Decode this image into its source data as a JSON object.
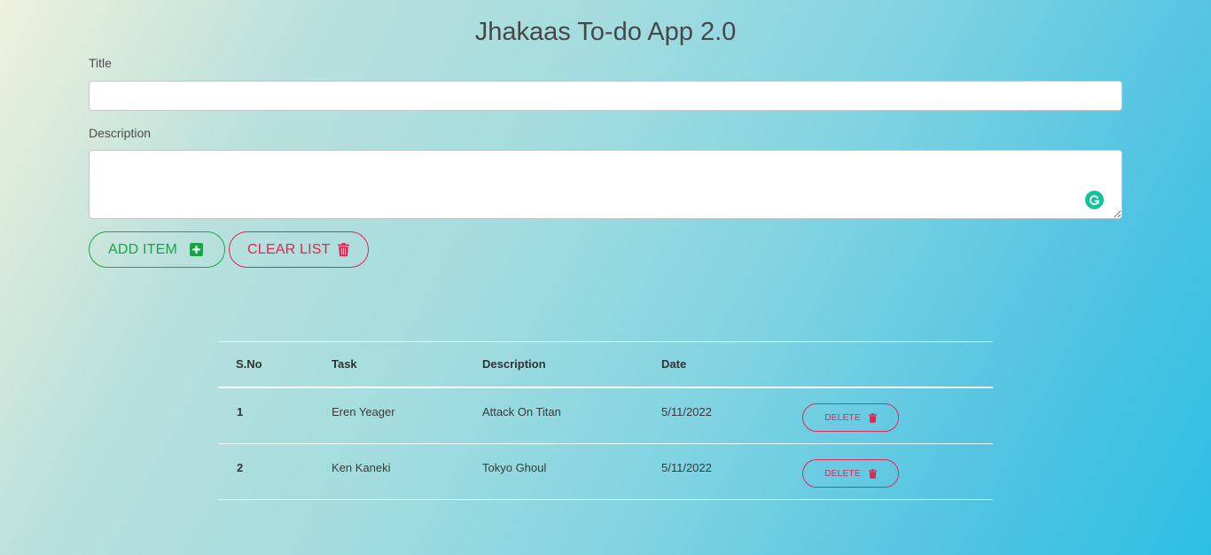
{
  "app": {
    "title": "Jhakaas To-do App 2.0"
  },
  "form": {
    "title_label": "Title",
    "title_value": "",
    "description_label": "Description",
    "description_value": "",
    "add_button_label": "ADD ITEM",
    "add_button_icon": "plus-square-icon",
    "clear_button_label": "CLEAR LIST",
    "clear_button_icon": "trash-icon"
  },
  "table": {
    "headers": [
      "S.No",
      "Task",
      "Description",
      "Date"
    ],
    "rows": [
      {
        "sno": "1",
        "task": "Eren Yeager",
        "description": "Attack On Titan",
        "date": "5/11/2022",
        "action_label": "DELETE"
      },
      {
        "sno": "2",
        "task": "Ken Kaneki",
        "description": "Tokyo Ghoul",
        "date": "5/11/2022",
        "action_label": "DELETE"
      }
    ]
  },
  "colors": {
    "add_green": "#16a34a",
    "delete_red": "#e5234f",
    "grammarly_green": "#15c39a"
  }
}
